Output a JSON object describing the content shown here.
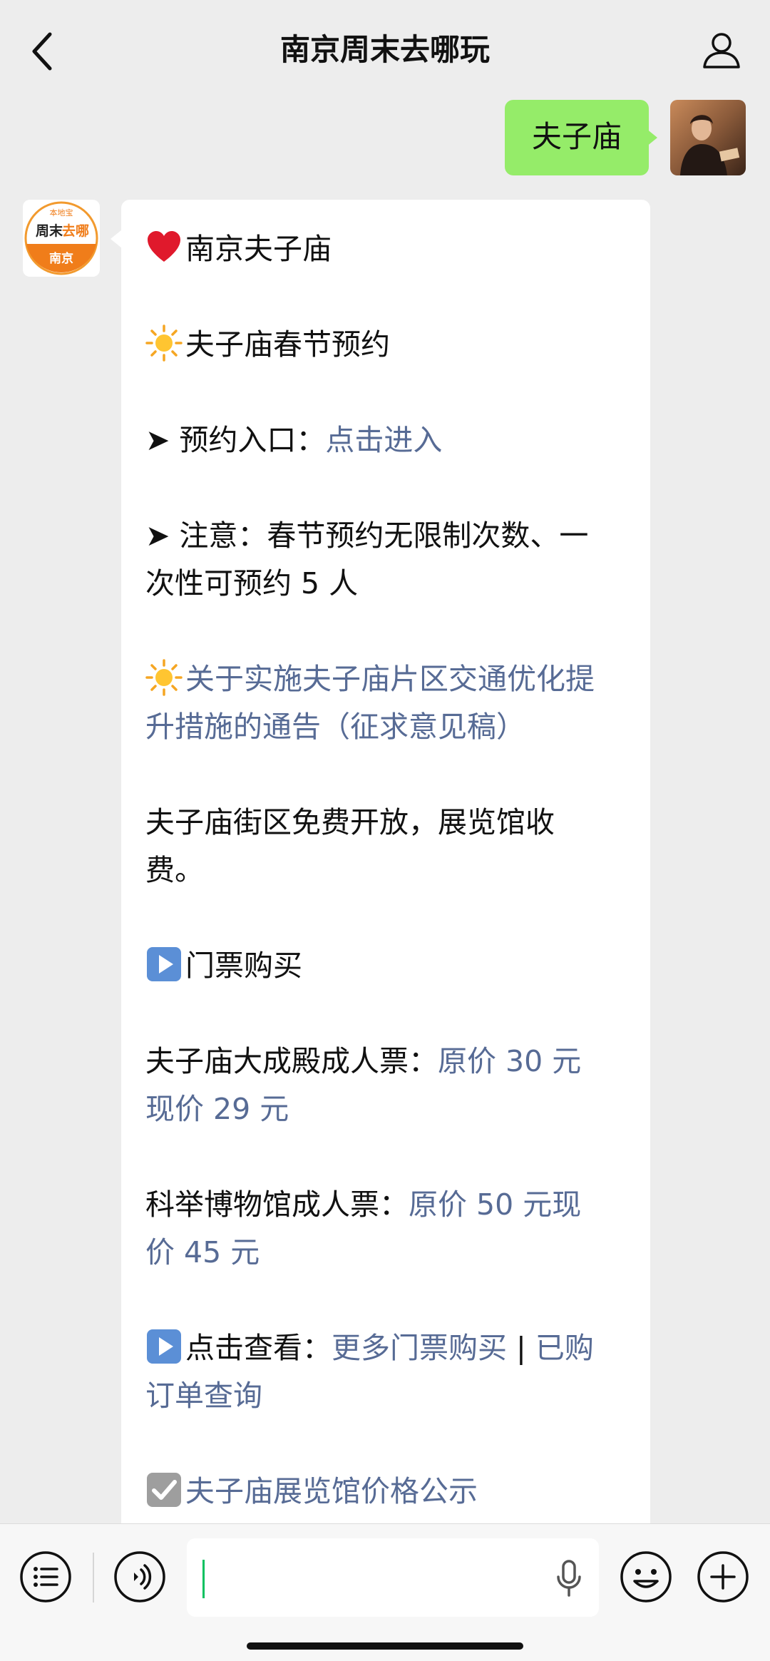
{
  "header": {
    "title": "南京周末去哪玩"
  },
  "outgoing": {
    "text": "夫子庙"
  },
  "bot_avatar": {
    "line1": "本地宝",
    "line2a": "周末",
    "line2b": "去哪",
    "line3": "南京"
  },
  "message": {
    "p1": "南京夫子庙",
    "p2": "夫子庙春节预约",
    "p3_prefix": "➤ 预约入口：",
    "p3_link": "点击进入",
    "p4": "➤ 注意：春节预约无限制次数、一\n次性可预约 5 人",
    "p5_link": "关于实施夫子庙片区交通优化提\n升措施的通告（征求意见稿）",
    "p6": "夫子庙街区免费开放，展览馆收\n费。",
    "p7": "门票购买",
    "p8_prefix": "夫子庙大成殿成人票：",
    "p8_link": "原价 30 元\n现价 29 元",
    "p9_prefix": "科举博物馆成人票：",
    "p9_link": "原价 50 元现\n价 45 元",
    "p10_prefix": "点击查看：",
    "p10_link1": "更多门票购买",
    "p10_sep": " | ",
    "p10_link2": "已购\n订单查询",
    "p11_link": "夫子庙展览馆价格公示"
  },
  "colors": {
    "link": "#576b95",
    "outgoing_bubble": "#95ec69",
    "input_caret": "#07c160"
  }
}
